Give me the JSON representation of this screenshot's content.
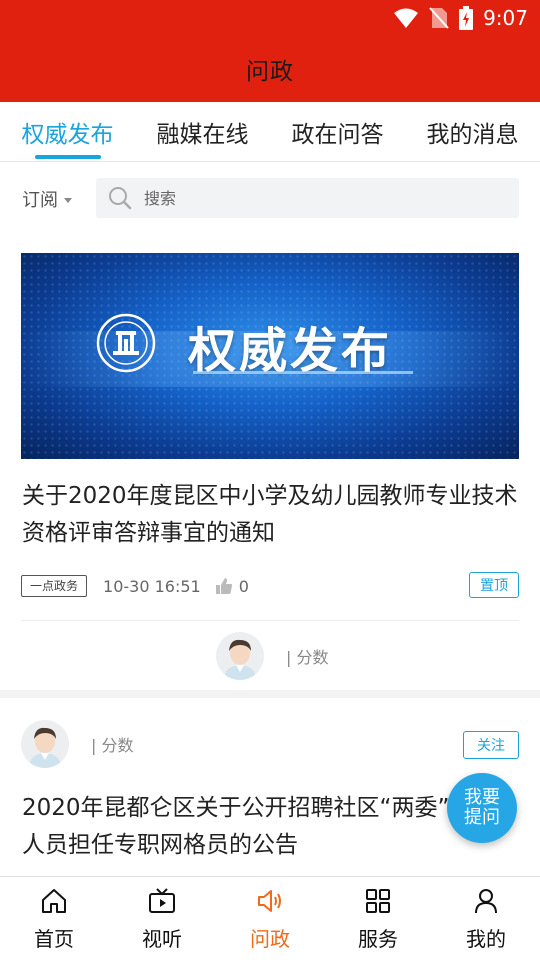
{
  "status_bar": {
    "time": "9:07"
  },
  "header": {
    "title": "问政"
  },
  "tabs": [
    {
      "label": "权威发布",
      "active": true
    },
    {
      "label": "融媒在线",
      "active": false
    },
    {
      "label": "政在问答",
      "active": false
    },
    {
      "label": "我的消息",
      "active": false
    }
  ],
  "filter": {
    "subscribe_label": "订阅"
  },
  "search": {
    "placeholder": "搜索"
  },
  "banner": {
    "text": "权威发布"
  },
  "article1": {
    "title": "关于2020年度昆区中小学及幼儿园教师专业技术资格评审答辩事宜的通知",
    "source_tag": "一点政务",
    "date": "10-30 16:51",
    "likes": "0",
    "pin_label": "置顶",
    "score_label": "| 分数"
  },
  "article2": {
    "score_label": "| 分数",
    "follow_label": "关注",
    "title": "2020年昆都仑区关于公开招聘社区“两委”工作人员担任专职网格员的公告"
  },
  "fab": {
    "line1": "我要",
    "line2": "提问"
  },
  "bottom_nav": [
    {
      "label": "首页",
      "icon": "home-icon"
    },
    {
      "label": "视听",
      "icon": "tv-icon"
    },
    {
      "label": "问政",
      "icon": "speaker-icon",
      "active": true
    },
    {
      "label": "服务",
      "icon": "grid-icon"
    },
    {
      "label": "我的",
      "icon": "user-icon"
    }
  ],
  "colors": {
    "brand_red": "#e0210f",
    "accent_blue": "#1aa4dc",
    "active_orange": "#ef6b1b"
  }
}
